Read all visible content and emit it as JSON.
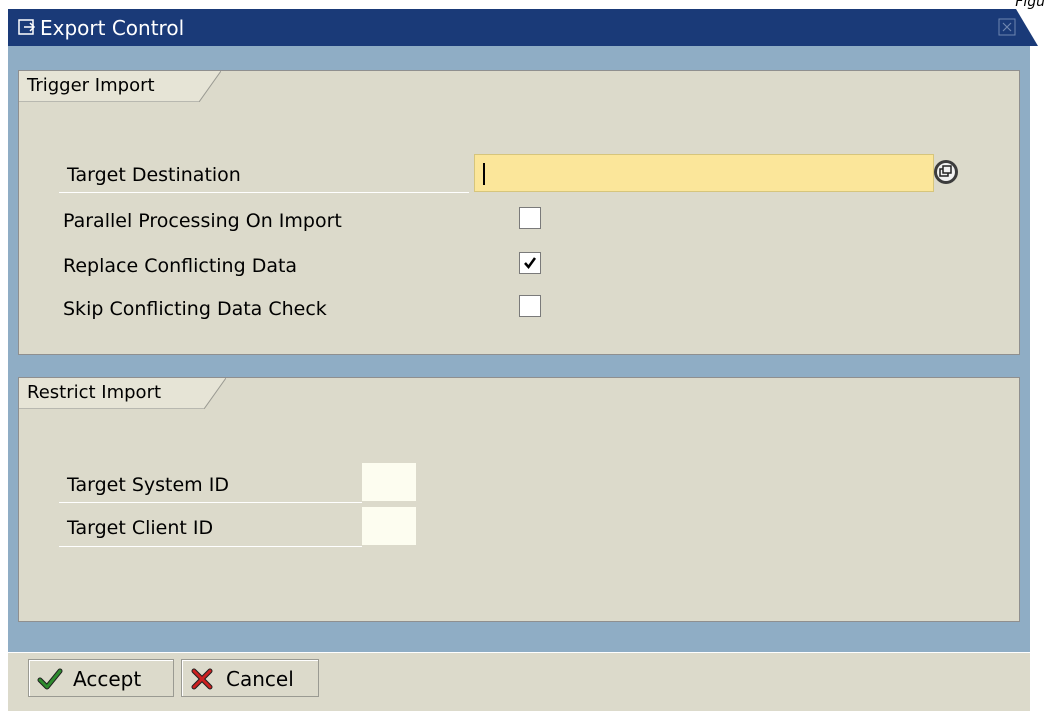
{
  "corner_text": "Figu",
  "window": {
    "title": "Export Control",
    "title_icon": "dialog-arrow-icon",
    "close_icon": "close-icon"
  },
  "trigger_import": {
    "header": "Trigger Import",
    "target_destination": {
      "label": "Target Destination",
      "value": "",
      "help_icon": "value-help-icon"
    },
    "options": [
      {
        "label": "Parallel Processing On Import",
        "checked": false
      },
      {
        "label": "Replace Conflicting Data",
        "checked": true
      },
      {
        "label": "Skip Conflicting Data Check",
        "checked": false
      }
    ]
  },
  "restrict_import": {
    "header": "Restrict Import",
    "target_system_id": {
      "label": "Target System ID",
      "value": ""
    },
    "target_client_id": {
      "label": "Target Client ID",
      "value": ""
    }
  },
  "footer": {
    "accept_label": "Accept",
    "accept_icon": "checkmark-icon",
    "cancel_label": "Cancel",
    "cancel_icon": "cross-icon"
  },
  "colors": {
    "titlebar": "#1a3a78",
    "dialog_bg": "#8fadc5",
    "group_bg": "#dcdacb",
    "required_input": "#fbe69a",
    "accept_green": "#2e8b2e",
    "cancel_red": "#cc1f1f"
  }
}
